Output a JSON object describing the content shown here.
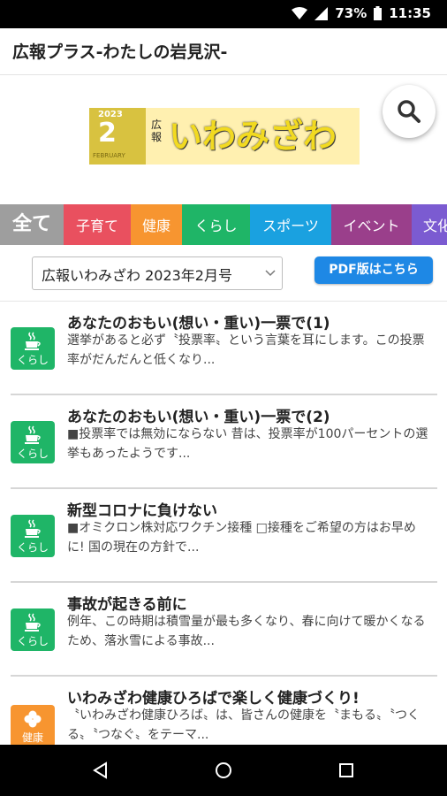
{
  "status": {
    "battery": "73%",
    "time": "11:35"
  },
  "app": {
    "title": "広報プラス-わたしの岩見沢-"
  },
  "banner": {
    "year": "2023",
    "month": "2",
    "feb": "FEBRUARY",
    "koho": "広報",
    "name": "いわみざわ"
  },
  "tabs": [
    {
      "label": "全て",
      "color": "#9e9e9e"
    },
    {
      "label": "子育て",
      "color": "#e9505f"
    },
    {
      "label": "健康",
      "color": "#f79530"
    },
    {
      "label": "くらし",
      "color": "#1fb567"
    },
    {
      "label": "スポーツ",
      "color": "#1aa1e0"
    },
    {
      "label": "イベント",
      "color": "#9a3f8b"
    },
    {
      "label": "文化",
      "color": "#7b5bd1"
    }
  ],
  "issue": {
    "selected": "広報いわみざわ 2023年2月号"
  },
  "pdf_button": {
    "label": "PDF版はこちら"
  },
  "articles": [
    {
      "category": "くらし",
      "icon": "coffee-cup-icon",
      "color": "#1fb567",
      "title": "あなたのおもい(想い・重い)一票で(1)",
      "summary": "選挙があると必ず〝投票率〟という言葉を耳にします。この投票率がだんだんと低くなり..."
    },
    {
      "category": "くらし",
      "icon": "coffee-cup-icon",
      "color": "#1fb567",
      "title": "あなたのおもい(想い・重い)一票で(2)",
      "summary": "■投票率では無効にならない 昔は、投票率が100パーセントの選挙もあったようです..."
    },
    {
      "category": "くらし",
      "icon": "coffee-cup-icon",
      "color": "#1fb567",
      "title": "新型コロナに負けない",
      "summary": "■オミクロン株対応ワクチン接種 □接種をご希望の方はお早めに! 国の現在の方針で..."
    },
    {
      "category": "くらし",
      "icon": "coffee-cup-icon",
      "color": "#1fb567",
      "title": "事故が起きる前に",
      "summary": "例年、この時期は積雪量が最も多くなり、春に向けて暖かくなるため、落氷雪による事故..."
    },
    {
      "category": "健康",
      "icon": "clover-icon",
      "color": "#f79530",
      "title": "いわみざわ健康ひろばで楽しく健康づくり!",
      "summary": "〝いわみざわ健康ひろば〟は、皆さんの健康を〝まもる〟〝つくる〟〝つなぐ〟をテーマ..."
    }
  ]
}
